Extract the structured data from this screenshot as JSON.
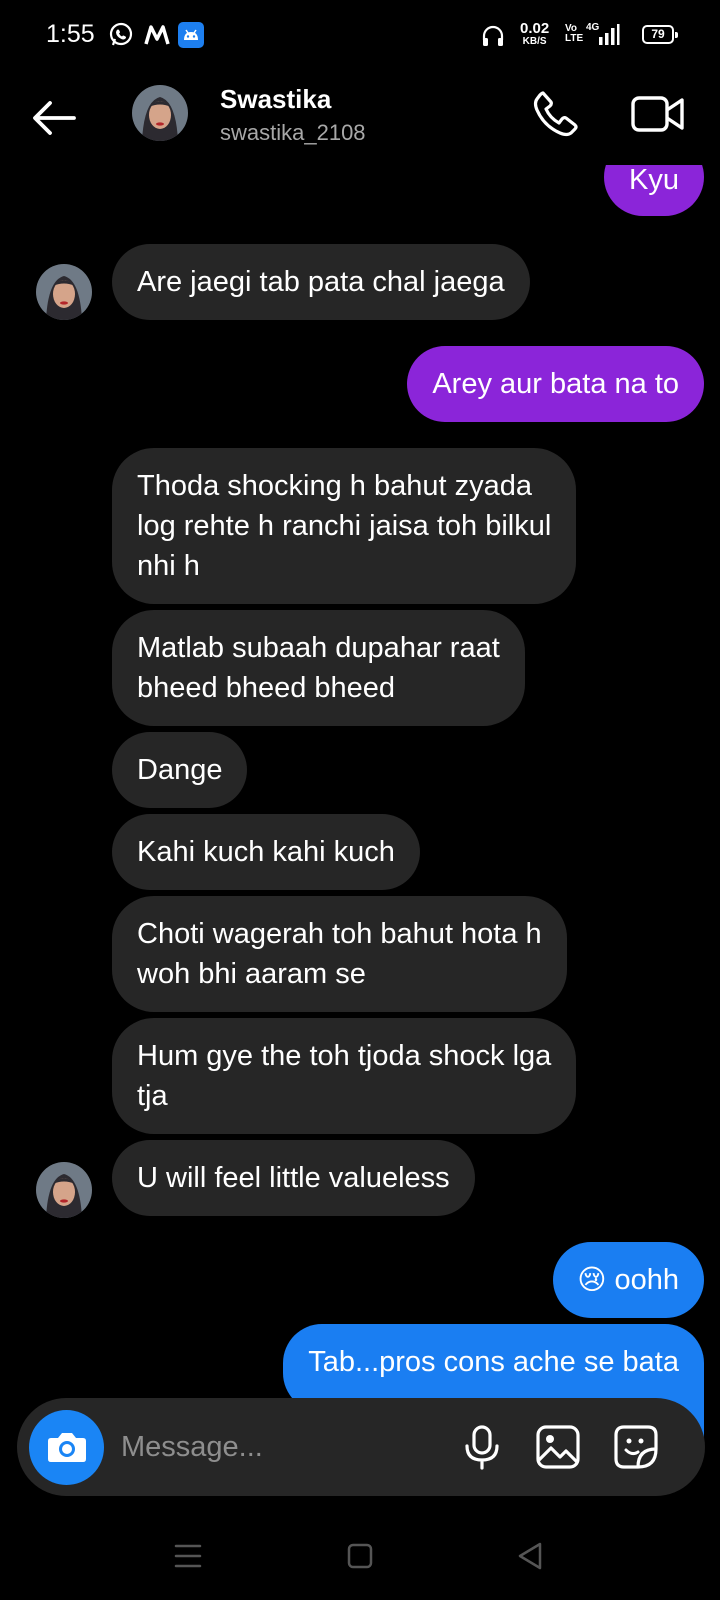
{
  "status_bar": {
    "time": "1:55",
    "net_speed": "0.02",
    "net_unit": "KB/S",
    "volte": "Vo LTE",
    "network": "4G",
    "battery": "79"
  },
  "header": {
    "name": "Swastika",
    "username": "swastika_2108"
  },
  "messages": [
    {
      "from": "me",
      "text": "Kyu"
    },
    {
      "from": "them",
      "text": "Are jaegi tab pata chal jaega"
    },
    {
      "from": "me",
      "text": "Arey aur bata na to"
    },
    {
      "from": "them",
      "lines": [
        "Thoda shocking h bahut zyada",
        "log rehte h ranchi jaisa toh bilkul",
        "nhi h"
      ]
    },
    {
      "from": "them",
      "lines": [
        "Matlab subaah dupahar raat",
        "bheed bheed bheed"
      ]
    },
    {
      "from": "them",
      "text": "Dange"
    },
    {
      "from": "them",
      "text": "Kahi kuch kahi kuch"
    },
    {
      "from": "them",
      "lines": [
        "Choti wagerah toh bahut hota h",
        "woh bhi aaram se"
      ]
    },
    {
      "from": "them",
      "lines": [
        "Hum gye the toh tjoda shock lga",
        "tja"
      ]
    },
    {
      "from": "them",
      "text": "U will feel little valueless"
    },
    {
      "from": "me",
      "emoji": "😢",
      "text": "oohh"
    },
    {
      "from": "me",
      "text": "Tab...pros cons ache se bata"
    }
  ],
  "composer": {
    "placeholder": "Message..."
  },
  "colors": {
    "background": "#000000",
    "incoming_bubble": "#262626",
    "outgoing_purple": "#8b25d9",
    "outgoing_blue": "#1a7ef2",
    "camera_button": "#1a85f5"
  },
  "icons": [
    "whatsapp-icon",
    "myntra-icon",
    "android-icon",
    "headset-icon",
    "back-arrow-icon",
    "phone-icon",
    "video-camera-icon",
    "camera-icon",
    "microphone-icon",
    "gallery-icon",
    "sticker-icon",
    "recents-icon",
    "home-icon",
    "back-icon"
  ]
}
